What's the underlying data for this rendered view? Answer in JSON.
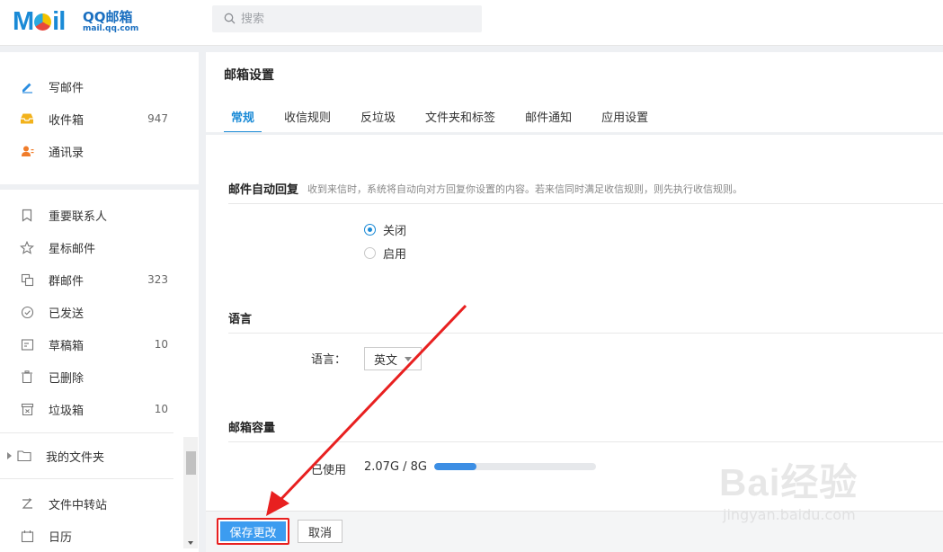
{
  "header": {
    "logo": {
      "word": "Mail",
      "brand": "QQ邮箱",
      "domain": "mail.qq.com"
    },
    "search_placeholder": "搜索",
    "search_icon": "search-icon"
  },
  "sidebar": {
    "primary": [
      {
        "label": "写邮件",
        "icon": "compose-icon"
      },
      {
        "label": "收件箱",
        "count": "947",
        "icon": "inbox-icon"
      },
      {
        "label": "通讯录",
        "icon": "contacts-icon"
      }
    ],
    "secondary": [
      {
        "label": "重要联系人",
        "icon": "bookmark-icon"
      },
      {
        "label": "星标邮件",
        "icon": "star-icon"
      },
      {
        "label": "群邮件",
        "count": "323",
        "icon": "group-icon"
      },
      {
        "label": "已发送",
        "icon": "sent-icon"
      },
      {
        "label": "草稿箱",
        "count": "10",
        "icon": "draft-icon"
      },
      {
        "label": "已删除",
        "icon": "trash-icon"
      },
      {
        "label": "垃圾箱",
        "count": "10",
        "icon": "junk-icon"
      }
    ],
    "folders_label": "我的文件夹",
    "transfer_label": "文件中转站",
    "calendar_label": "日历"
  },
  "main": {
    "title": "邮箱设置",
    "tabs": [
      "常规",
      "收信规则",
      "反垃圾",
      "文件夹和标签",
      "邮件通知",
      "应用设置"
    ],
    "active_tab": "常规",
    "auto_reply": {
      "heading": "邮件自动回复",
      "desc": "收到来信时，系统将自动向对方回复你设置的内容。若来信同时满足收信规则，则先执行收信规则。",
      "options": [
        "关闭",
        "启用"
      ],
      "selected": "关闭"
    },
    "language": {
      "heading": "语言",
      "label": "语言：",
      "value": "英文"
    },
    "capacity": {
      "heading": "邮箱容量",
      "used_label": "已使用",
      "used_text": "2.07G / 8G",
      "used_fraction": 0.26
    },
    "buttons": {
      "save": "保存更改",
      "cancel": "取消"
    }
  },
  "annotation_color": "#e82020",
  "watermark": {
    "big": "Bai经验",
    "small": "jingyan.baidu.com"
  }
}
